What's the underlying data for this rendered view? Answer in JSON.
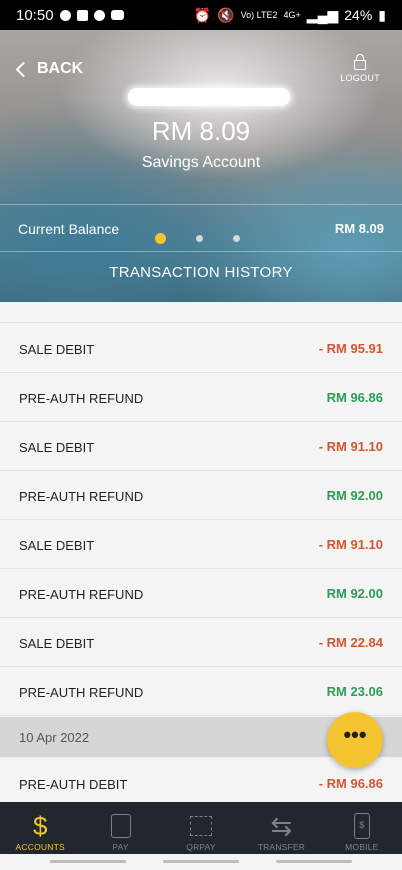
{
  "status_bar": {
    "time": "10:50",
    "network": "Vo) LTE2",
    "signal": "4G+",
    "battery": "24%"
  },
  "header": {
    "back_label": "BACK",
    "logout_label": "LOGOUT",
    "balance_amount": "RM 8.09",
    "account_type": "Savings Account",
    "current_balance_label": "Current Balance",
    "current_balance_value": "RM 8.09",
    "history_title": "TRANSACTION HISTORY"
  },
  "transactions": [
    {
      "desc": "SALE DEBIT",
      "amount": "- RM 95.91",
      "type": "debit"
    },
    {
      "desc": "PRE-AUTH REFUND",
      "amount": "RM 96.86",
      "type": "credit"
    },
    {
      "desc": "SALE DEBIT",
      "amount": "- RM 91.10",
      "type": "debit"
    },
    {
      "desc": "PRE-AUTH REFUND",
      "amount": "RM 92.00",
      "type": "credit"
    },
    {
      "desc": "SALE DEBIT",
      "amount": "- RM 91.10",
      "type": "debit"
    },
    {
      "desc": "PRE-AUTH REFUND",
      "amount": "RM 92.00",
      "type": "credit"
    },
    {
      "desc": "SALE DEBIT",
      "amount": "- RM 22.84",
      "type": "debit"
    },
    {
      "desc": "PRE-AUTH REFUND",
      "amount": "RM 23.06",
      "type": "credit"
    }
  ],
  "date_group": "10 Apr 2022",
  "after_date": {
    "desc": "PRE-AUTH DEBIT",
    "amount": "- RM 96.86",
    "type": "debit"
  },
  "fab_label": "•••",
  "nav": [
    {
      "label": "ACCOUNTS",
      "icon": "dollar-icon"
    },
    {
      "label": "PAY",
      "icon": "bill-icon"
    },
    {
      "label": "QRPAY",
      "icon": "qr-icon"
    },
    {
      "label": "TRANSFER",
      "icon": "transfer-icon"
    },
    {
      "label": "MOBILE",
      "icon": "mobile-icon"
    }
  ],
  "colors": {
    "accent": "#f4c430",
    "debit": "#d2562f",
    "credit": "#2e9c57"
  }
}
